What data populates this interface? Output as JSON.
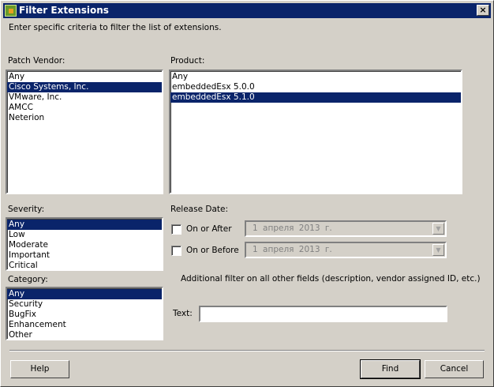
{
  "window": {
    "title": "Filter Extensions",
    "close": "×"
  },
  "description": "Enter specific criteria to filter the list of extensions.",
  "vendor": {
    "label": "Patch Vendor:",
    "items": [
      "Any",
      "Cisco Systems, Inc.",
      "VMware, Inc.",
      "AMCC",
      "Neterion"
    ],
    "selected": 1
  },
  "product": {
    "label": "Product:",
    "items": [
      "Any",
      "embeddedEsx 5.0.0",
      "embeddedEsx 5.1.0"
    ],
    "selected": 2
  },
  "severity": {
    "label": "Severity:",
    "items": [
      "Any",
      "Low",
      "Moderate",
      "Important",
      "Critical"
    ],
    "selected": 0
  },
  "category": {
    "label": "Category:",
    "items": [
      "Any",
      "Security",
      "BugFix",
      "Enhancement",
      "Other"
    ],
    "selected": 0
  },
  "release": {
    "label": "Release Date:",
    "after_label": "On or After",
    "after_date": "1 апреля 2013 г.",
    "before_label": "On or Before",
    "before_date": "1 апреля 2013 г."
  },
  "additional": "Additional filter on all other fields (description, vendor assigned ID, etc.)",
  "text": {
    "label": "Text:",
    "value": ""
  },
  "buttons": {
    "help": "Help",
    "find": "Find",
    "cancel": "Cancel"
  }
}
